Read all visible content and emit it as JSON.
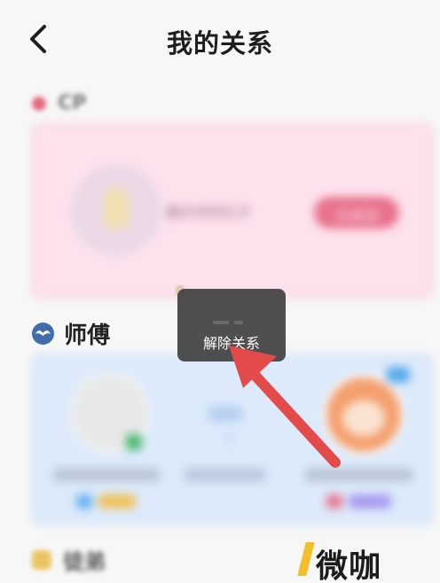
{
  "header": {
    "title": "我的关系"
  },
  "cp_section": {
    "title": "CP",
    "card_text": "邀约你的CP",
    "action_label": "去邀请"
  },
  "master_section": {
    "title": "师傅"
  },
  "next_section": {
    "title": "徒弟"
  },
  "popup": {
    "label": "解除关系"
  },
  "watermark": {
    "text": "微咖"
  },
  "colors": {
    "cp_card": "#fde1ec",
    "master_card": "#dceafb",
    "popup_bg": "#424242",
    "arrow": "#e34a4a",
    "watermark_accent": "#f2be2a"
  },
  "icons": {
    "back": "chevron-left-icon",
    "master_badge": "mustache-icon"
  }
}
